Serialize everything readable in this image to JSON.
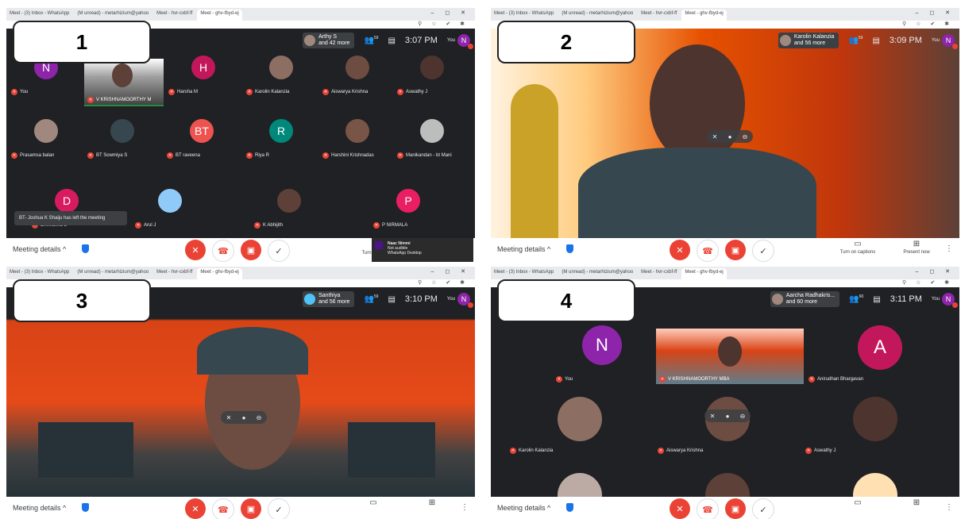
{
  "browser": {
    "tabs": [
      "Meet - (3) Inbox - WhatsApp",
      "(M unread) - metarhizium@yahoo",
      "Meet - hvr-cxbf-ff",
      "Meet - ghv-fbyd-ej"
    ],
    "window_controls": "– ◻ ✕",
    "toolbar_icons": "⚲ ☆ ✔ ✱"
  },
  "panels": [
    {
      "number": "1",
      "clock": "3:07 PM",
      "chip_name": "Arthy S",
      "chip_more": "and 42 more",
      "people_count": "59",
      "you_label": "You",
      "participants": [
        {
          "name": "You",
          "initial": "N",
          "color": "#8e24aa"
        },
        {
          "name": "V KRISHNAMOORTHY M",
          "initial": "",
          "color": ""
        },
        {
          "name": "Harsha M",
          "initial": "H",
          "color": "#c2185b"
        },
        {
          "name": "Karolin Kalanzia",
          "initial": "",
          "color": "#8d6e63"
        },
        {
          "name": "Aiswarya Krishna",
          "initial": "",
          "color": "#6d4c41"
        },
        {
          "name": "Aswathy J",
          "initial": "",
          "color": "#4e342e"
        },
        {
          "name": "Prasamsa balan",
          "initial": "",
          "color": "#a1887f"
        },
        {
          "name": "BT Sowmiya S",
          "initial": "",
          "color": "#37474f"
        },
        {
          "name": "BT raveena",
          "initial": "BT",
          "color": "#ef5350"
        },
        {
          "name": "Riya R",
          "initial": "R",
          "color": "#00897b"
        },
        {
          "name": "Harshini Krishnadas",
          "initial": "",
          "color": "#795548"
        },
        {
          "name": "Manikandan - bt Mani",
          "initial": "",
          "color": "#bdbdbd"
        },
        {
          "name": "Dr.Krishnu L",
          "initial": "D",
          "color": "#d81b60"
        },
        {
          "name": "Arul J",
          "initial": "",
          "color": "#90caf9"
        },
        {
          "name": "K Abhijith",
          "initial": "",
          "color": "#5d4037"
        },
        {
          "name": "P NIRMALA",
          "initial": "P",
          "color": "#e91e63"
        }
      ],
      "toast": "BT- Joshua K Shaiju has left the meeting",
      "notification": {
        "title": "Naac Nimmi",
        "line1": "Not audible",
        "line2": "WhatsApp Desktop"
      },
      "meeting_details": "Meeting details ^",
      "turn_on_partial": "Turn o"
    },
    {
      "number": "2",
      "clock": "3:09 PM",
      "chip_name": "Karolin Kalanzia",
      "chip_more": "and 56 more",
      "people_count": "59",
      "you_label": "You",
      "meeting_details": "Meeting details ^",
      "captions": "Turn on captions",
      "present": "Present now"
    },
    {
      "number": "3",
      "clock": "3:10 PM",
      "chip_name": "Santhiya",
      "chip_more": "and 56 more",
      "people_count": "59",
      "you_label": "You",
      "meeting_details": "Meeting details ^"
    },
    {
      "number": "4",
      "clock": "3:11 PM",
      "chip_name": "Aarcha Radhakris...",
      "chip_more": "and 60 more",
      "people_count": "60",
      "you_label": "You",
      "participants": [
        {
          "name": "You",
          "initial": "N",
          "color": "#8e24aa"
        },
        {
          "name": "V KRISHNAMOORTHY MBA",
          "initial": "",
          "color": ""
        },
        {
          "name": "Anirudhan Bhargavan",
          "initial": "A",
          "color": "#c2185b"
        },
        {
          "name": "Karolin Kalanzia",
          "initial": "",
          "color": "#8d6e63"
        },
        {
          "name": "Aiswarya Krishna",
          "initial": "",
          "color": "#6d4c41"
        },
        {
          "name": "Aswathy J",
          "initial": "",
          "color": "#4e342e"
        }
      ],
      "meeting_details": "Meeting details ^"
    }
  ],
  "icons": {
    "mic_off": "🎙",
    "hangup": "☎",
    "cam_off": "⃠",
    "check": "✓",
    "people": "👥",
    "chat": "▤",
    "more": "⋮"
  }
}
